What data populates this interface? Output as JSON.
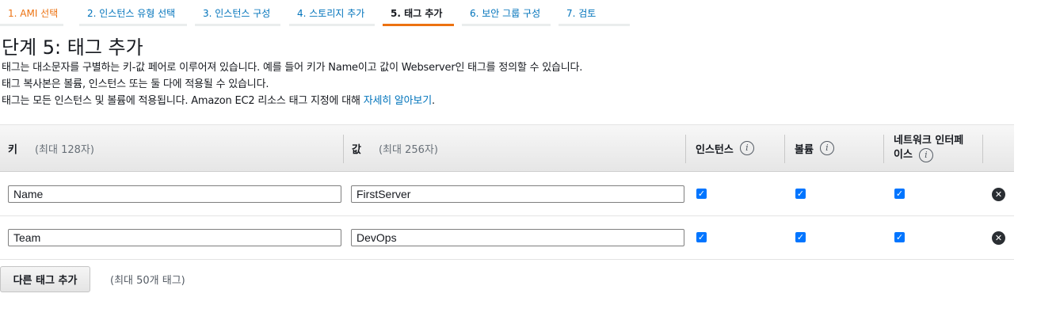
{
  "steps": [
    {
      "label": "1. AMI 선택"
    },
    {
      "label": "2. 인스턴스 유형 선택"
    },
    {
      "label": "3. 인스턴스 구성"
    },
    {
      "label": "4. 스토리지 추가"
    },
    {
      "label": "5. 태그 추가"
    },
    {
      "label": "6. 보안 그룹 구성"
    },
    {
      "label": "7. 검토"
    }
  ],
  "current_step": 5,
  "page": {
    "title": "단계 5: 태그 추가",
    "desc_line1": "태그는 대소문자를 구별하는 키-값 페어로 이루어져 있습니다. 예를 들어 키가 Name이고 값이 Webserver인 태그를 정의할 수 있습니다.",
    "desc_line2": "태그 복사본은 볼륨, 인스턴스 또는 둘 다에 적용될 수 있습니다.",
    "desc_line3": "태그는 모든 인스턴스 및 볼륨에 적용됩니다. Amazon EC2 리소스 태그 지정에 대해 ",
    "learn_more_link": "자세히 알아보기",
    "desc_line3_end": "."
  },
  "table": {
    "headers": {
      "key": "키",
      "key_hint": "(최대 128자)",
      "value": "값",
      "value_hint": "(최대 256자)",
      "instances": "인스턴스",
      "volumes": "볼륨",
      "network_line1": "네트워크 인터페",
      "network_line2": "이스"
    },
    "rows": [
      {
        "key": "Name",
        "value": "FirstServer",
        "instances": true,
        "volumes": true,
        "network": true
      },
      {
        "key": "Team",
        "value": "DevOps",
        "instances": true,
        "volumes": true,
        "network": true
      }
    ]
  },
  "add_tag": {
    "button": "다른 태그 추가",
    "hint": "(최대 50개 태그)"
  },
  "icons": {
    "info": "info-icon",
    "remove": "remove-circle-icon",
    "checkbox": "checkbox-checked-icon"
  },
  "colors": {
    "link": "#0073bb",
    "completed_step": "#ec7211",
    "active_underline": "#ec7211",
    "checkbox": "#0075ff"
  }
}
